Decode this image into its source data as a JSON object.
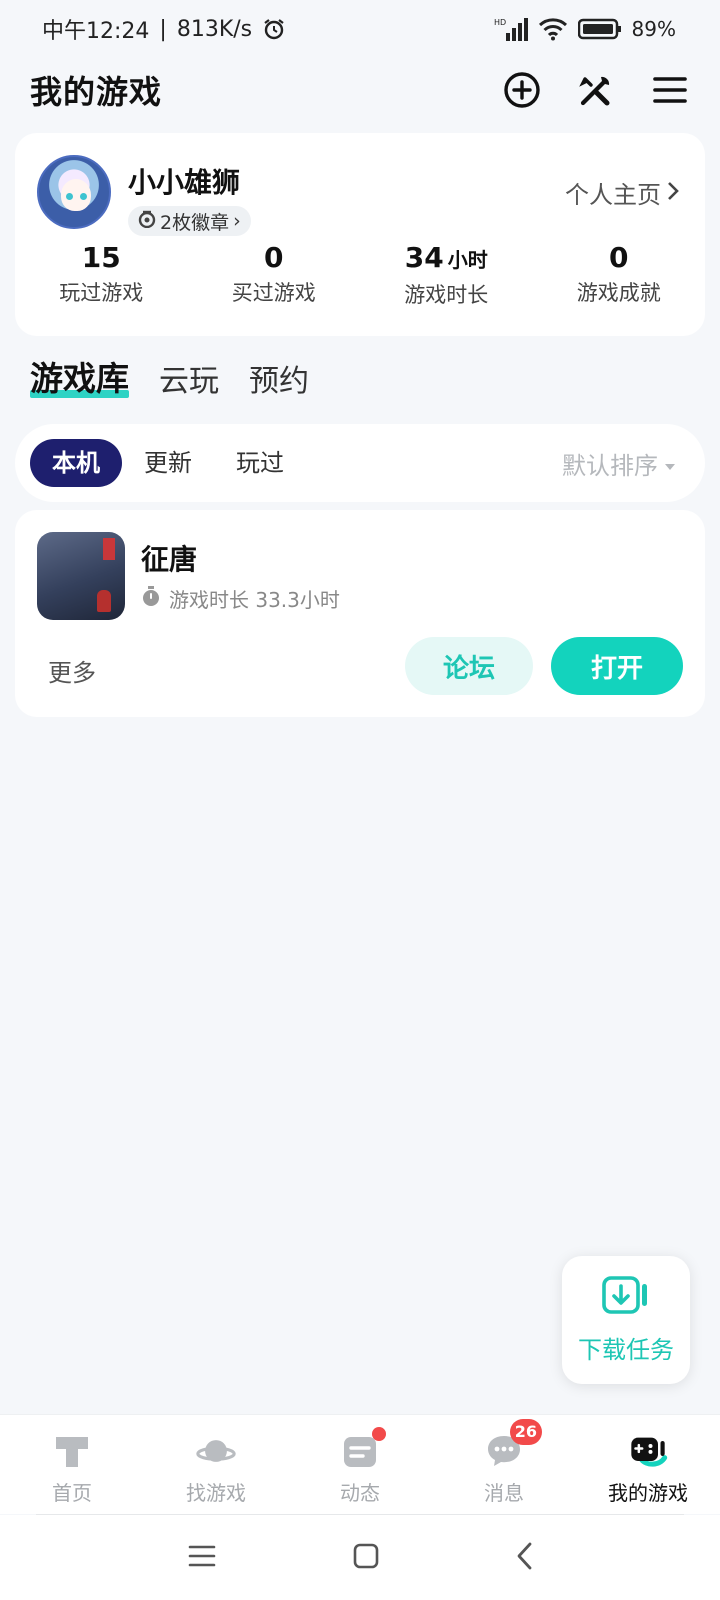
{
  "status_bar": {
    "time": "中午12:24",
    "speed": "813K/s",
    "battery": "89%"
  },
  "header": {
    "title": "我的游戏",
    "icons": [
      "add-circle-icon",
      "tools-icon",
      "menu-icon"
    ]
  },
  "profile": {
    "username": "小小雄狮",
    "badges": "2枚徽章",
    "home_link": "个人主页",
    "stats": [
      {
        "value": "15",
        "unit": "",
        "label": "玩过游戏"
      },
      {
        "value": "0",
        "unit": "",
        "label": "买过游戏"
      },
      {
        "value": "34",
        "unit": "小时",
        "label": "游戏时长"
      },
      {
        "value": "0",
        "unit": "",
        "label": "游戏成就"
      }
    ]
  },
  "library_tabs": [
    "游戏库",
    "云玩",
    "预约"
  ],
  "filters": {
    "chips": [
      "本机",
      "更新",
      "玩过"
    ],
    "sort": "默认排序"
  },
  "game": {
    "name": "征唐",
    "playtime": "游戏时长 33.3小时",
    "more": "更多",
    "forum": "论坛",
    "open": "打开"
  },
  "download_task": "下载任务",
  "bottom_nav": {
    "items": [
      "首页",
      "找游戏",
      "动态",
      "消息",
      "我的游戏"
    ],
    "message_count": "26"
  },
  "colors": {
    "accent": "#13d3bd",
    "active_chip": "#1e1f6e",
    "badge_red": "#f24a4a"
  }
}
